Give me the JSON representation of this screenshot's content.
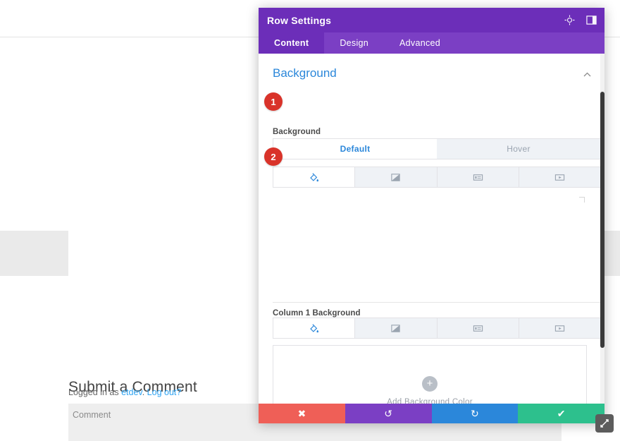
{
  "page": {
    "submit_heading": "Submit a Comment",
    "logged_in_prefix": "Logged in as ",
    "logged_in_user": "etdev",
    "logged_in_sep": ". ",
    "logout_label": "Log out?",
    "comment_placeholder": "Comment"
  },
  "modal": {
    "title": "Row Settings",
    "header_icons": [
      {
        "name": "target-icon",
        "glyph": "⌖"
      },
      {
        "name": "layout-toggle-icon",
        "glyph": "◧"
      }
    ],
    "tabs": [
      {
        "label": "Content",
        "active": true
      },
      {
        "label": "Design",
        "active": false
      },
      {
        "label": "Advanced",
        "active": false
      }
    ],
    "section": {
      "title": "Background",
      "collapse_icon": "chevron-up-icon"
    },
    "background_field": {
      "label": "Background",
      "state_tabs": [
        {
          "label": "Default",
          "active": true
        },
        {
          "label": "Hover",
          "active": false
        }
      ],
      "types": [
        {
          "name": "color-fill-icon",
          "active": true
        },
        {
          "name": "gradient-icon",
          "active": false
        },
        {
          "name": "image-icon",
          "active": false
        },
        {
          "name": "video-icon",
          "active": false
        }
      ]
    },
    "column_field": {
      "label": "Column 1 Background",
      "types": [
        {
          "name": "color-fill-icon",
          "active": true
        },
        {
          "name": "gradient-icon",
          "active": false
        },
        {
          "name": "image-icon",
          "active": false
        },
        {
          "name": "video-icon",
          "active": false
        }
      ],
      "add_label": "Add Background Color",
      "add_icon": "plus-icon"
    },
    "footer": [
      {
        "name": "cancel-button",
        "icon": "✖",
        "color": "#ef5f57"
      },
      {
        "name": "undo-button",
        "icon": "↺",
        "color": "#7b3fc4"
      },
      {
        "name": "redo-button",
        "icon": "↻",
        "color": "#2b87da"
      },
      {
        "name": "save-button",
        "icon": "✔",
        "color": "#2dc08d"
      }
    ]
  },
  "callouts": [
    {
      "number": "1"
    },
    {
      "number": "2"
    }
  ],
  "colors": {
    "header_purple": "#6c2eb9",
    "tabbar_purple": "#7b3fc4",
    "accent_blue": "#2b87da",
    "callout_red": "#d9332a"
  }
}
